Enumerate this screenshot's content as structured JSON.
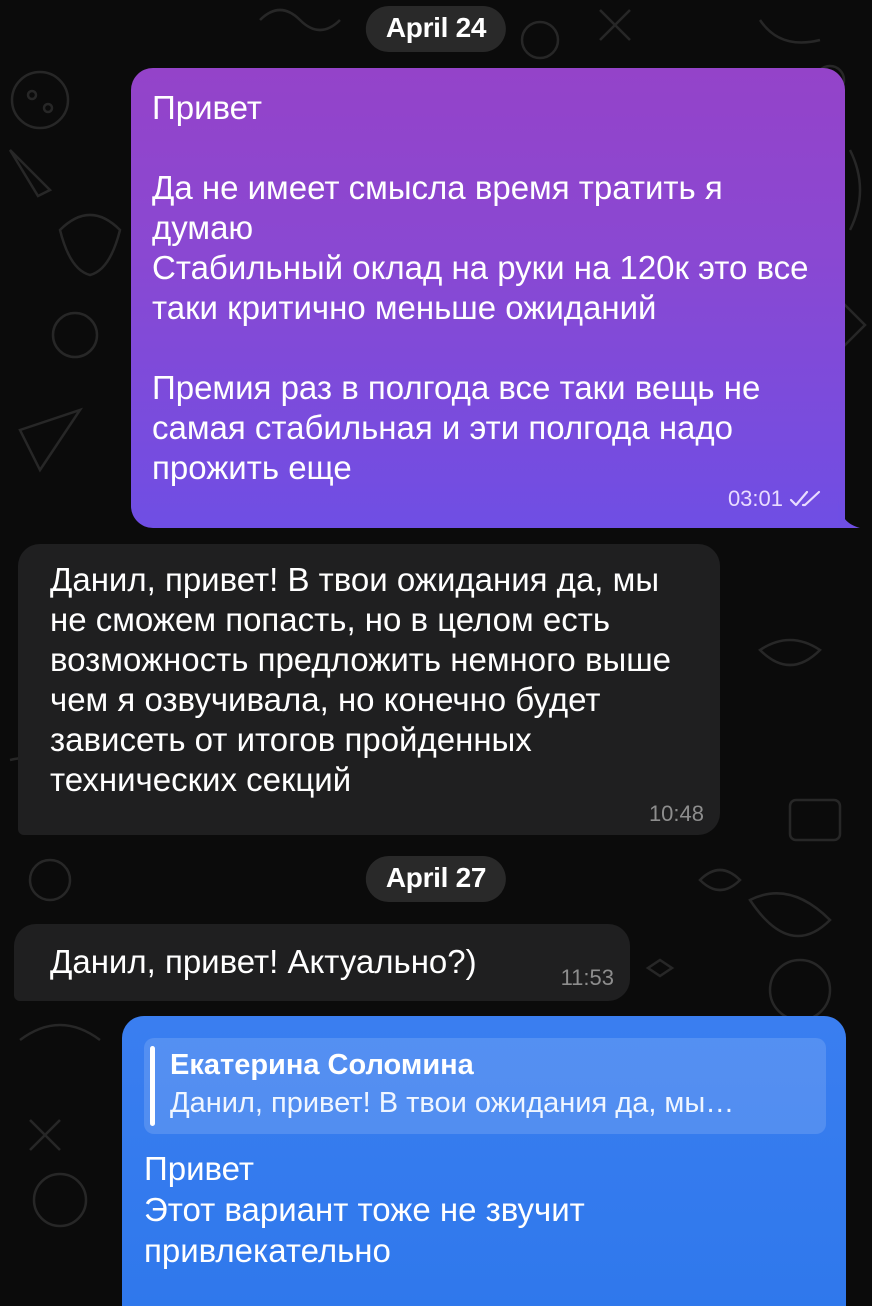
{
  "chat": {
    "dates": [
      "April 24",
      "April 27"
    ],
    "messages": [
      {
        "direction": "outgoing",
        "text": "Привет\n\nДа не имеет смысла время тратить я думаю\nСтабильный оклад на руки на 120к это все таки критично меньше ожиданий\n\nПремия раз в полгода все таки вещь не самая стабильная и эти полгода надо прожить еще",
        "time": "03:01",
        "status_icon": "double-check-icon"
      },
      {
        "direction": "incoming",
        "text": "Данил, привет! В твои ожидания да, мы не сможем попасть, но в целом есть возможность предложить немного выше чем я озвучивала, но конечно будет зависеть от итогов пройденных технических секций",
        "time": "10:48"
      },
      {
        "direction": "incoming",
        "text": "Данил, привет! Актуально?)",
        "time": "11:53"
      },
      {
        "direction": "outgoing",
        "reply": {
          "author": "Екатерина Соломина",
          "text": "Данил, привет! В твои ожидания да, мы…"
        },
        "text": "Привет\nЭтот вариант тоже не звучит привлекательно"
      }
    ]
  },
  "colors": {
    "background": "#0b0b0b",
    "outgoing_gradient_top": "#9443c9",
    "outgoing_gradient_bottom": "#6f4ee4",
    "incoming_bubble": "#1f1f20",
    "reply_bubble": "#3a7ef0",
    "date_pill": "#2d2d2d"
  }
}
